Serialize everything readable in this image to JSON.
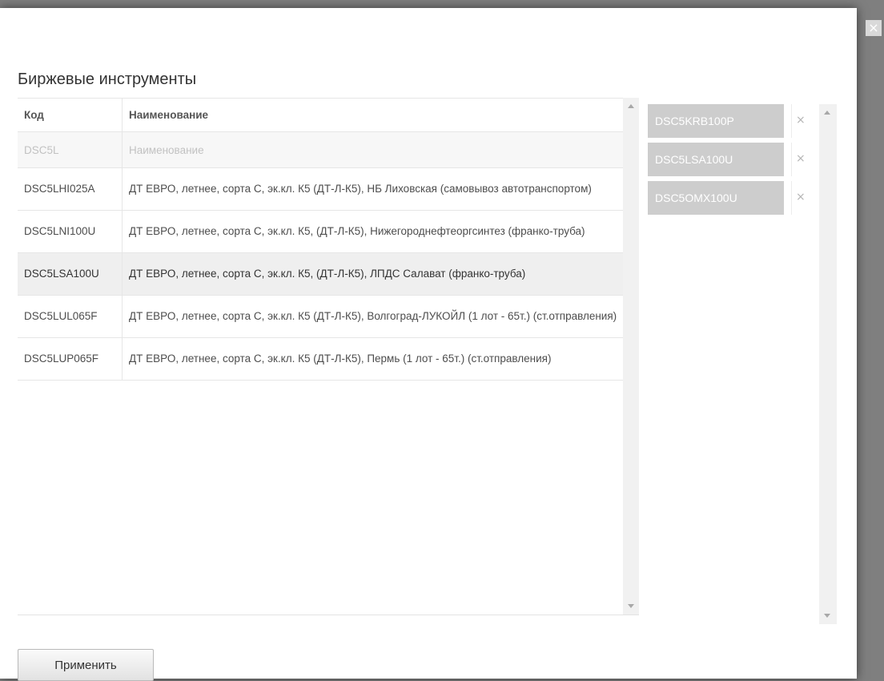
{
  "dialog": {
    "title": "Биржевые инструменты",
    "close_label": "×",
    "apply_label": "Применить"
  },
  "table": {
    "headers": {
      "code": "Код",
      "name": "Наименование"
    },
    "filter": {
      "code_value": "DSC5L",
      "name_placeholder": "Наименование"
    },
    "rows": [
      {
        "code": "DSC5LHI025A",
        "name": "ДТ ЕВРО, летнее, сорта С, эк.кл. К5 (ДТ-Л-К5), НБ Лиховская (самовывоз автотранспортом)"
      },
      {
        "code": "DSC5LNI100U",
        "name": "ДТ ЕВРО, летнее, сорта С, эк.кл. К5, (ДТ-Л-К5), Нижегороднефтеоргсинтез (франко-труба)"
      },
      {
        "code": "DSC5LSA100U",
        "name": "ДТ ЕВРО, летнее, сорта С, эк.кл. К5, (ДТ-Л-К5), ЛПДС Салават (франко-труба)",
        "selected": true
      },
      {
        "code": "DSC5LUL065F",
        "name": "ДТ ЕВРО, летнее, сорта С, эк.кл. К5 (ДТ-Л-К5), Волгоград-ЛУКОЙЛ (1 лот - 65т.) (ст.отправления)"
      },
      {
        "code": "DSC5LUP065F",
        "name": "ДТ ЕВРО, летнее, сорта С, эк.кл. К5 (ДТ-Л-К5), Пермь (1 лот - 65т.) (ст.отправления)"
      }
    ]
  },
  "selected_items": [
    {
      "code": "DSC5KRB100P",
      "remove": "×"
    },
    {
      "code": "DSC5LSA100U",
      "remove": "×"
    },
    {
      "code": "DSC5OMX100U",
      "remove": "×"
    }
  ],
  "icons": {
    "close": "close-icon",
    "remove": "remove-icon",
    "scroll_up": "scroll-up-arrow",
    "scroll_down": "scroll-down-arrow"
  }
}
